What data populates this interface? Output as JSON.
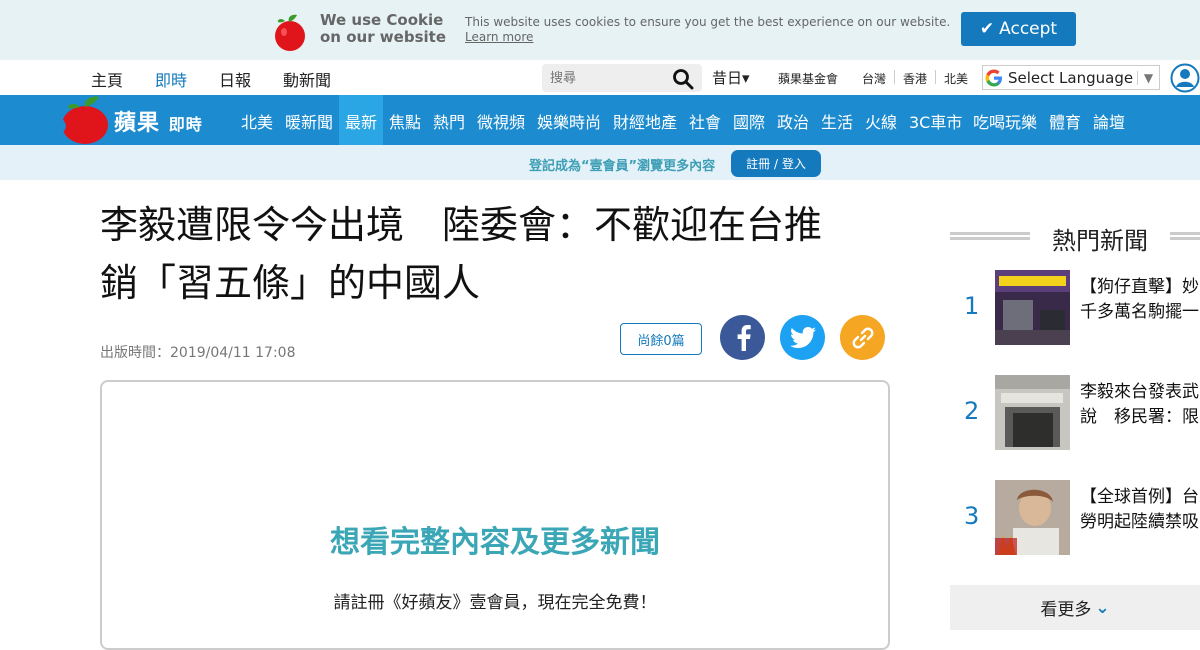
{
  "cookie": {
    "title": "We use Cookie on our website",
    "message": "This website uses cookies to ensure you get the best experience on our website.",
    "learn_more": "Learn more",
    "accept": "Accept"
  },
  "topnav": {
    "items": [
      "主頁",
      "即時",
      "日報",
      "動新聞"
    ],
    "active": "即時",
    "search_placeholder": "搜尋",
    "archive": "昔日▾",
    "foundation": "蘋果基金會",
    "regions": [
      "台灣",
      "香港",
      "北美"
    ],
    "language": "Select Language",
    "language_arrow": "▼"
  },
  "bluebar": {
    "logo_text": "蘋果",
    "logo_sub": "即時",
    "categories": [
      "北美",
      "暖新聞",
      "最新",
      "焦點",
      "熱門",
      "微視頻",
      "娛樂時尚",
      "財經地產",
      "社會",
      "國際",
      "政治",
      "生活",
      "火線",
      "3C車市",
      "吃喝玩樂",
      "體育",
      "論壇"
    ],
    "active": "最新"
  },
  "regbar": {
    "text": "登記成為“壹會員”瀏覽更多內容",
    "button": "註冊 / 登入"
  },
  "article": {
    "headline_line1": "李毅遭限令今出境　陸委會：不歡迎在台推",
    "headline_line2": "銷「習五條」的中國人",
    "published": "出版時間：2019/04/11 17:08",
    "remaining": "尚餘0篇",
    "paywall_title": "想看完整內容及更多新聞",
    "paywall_sub": "請註冊《好蘋友》壹會員，現在完全免費！"
  },
  "sidebar": {
    "title": "熱門新聞",
    "items": [
      {
        "rank": "1",
        "title_line1": "【狗仔直擊】妙",
        "title_line2": "千多萬名駒擺一"
      },
      {
        "rank": "2",
        "title_line1": "李毅來台發表武",
        "title_line2": "說　移民署：限"
      },
      {
        "rank": "3",
        "title_line1": "【全球首例】台",
        "title_line2": "勞明起陸續禁吸"
      }
    ],
    "more": "看更多"
  },
  "colors": {
    "brand_blue": "#1c8bcf",
    "active_blue": "#2aa6e4",
    "link_blue": "#1479bd",
    "teal": "#3aa6b6",
    "facebook": "#3b5998",
    "twitter": "#1da1f2",
    "copy_link": "#f5a623"
  }
}
